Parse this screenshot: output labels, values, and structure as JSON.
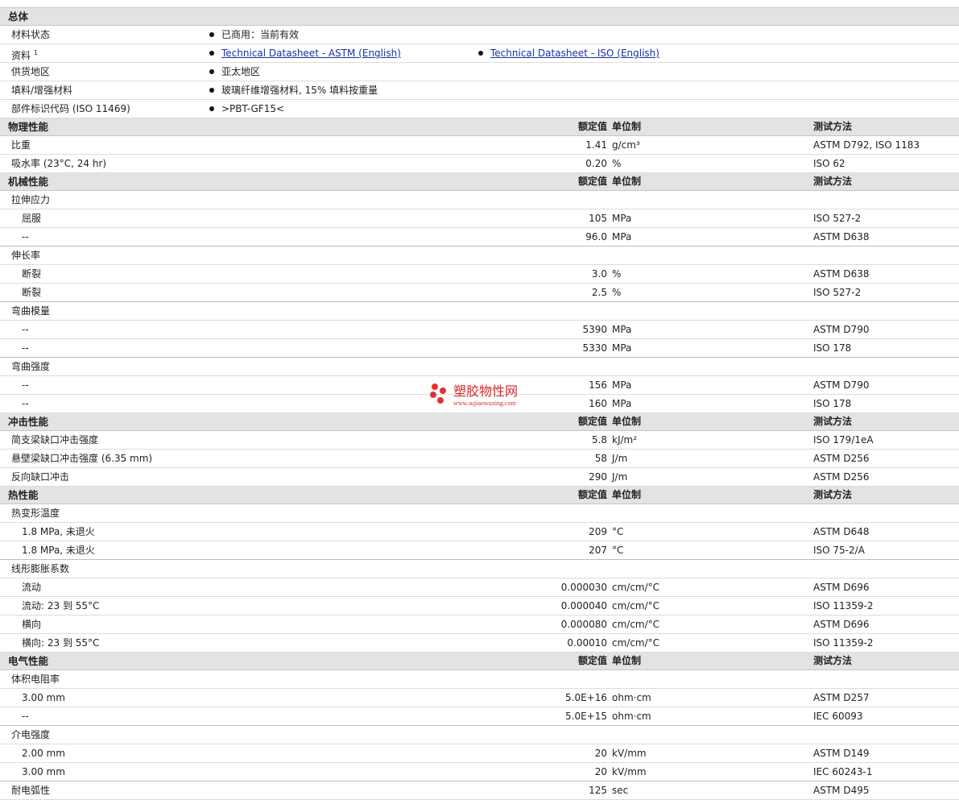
{
  "sections": [
    {
      "title": "总体",
      "rows": [
        {
          "label": "材料状态",
          "bullets": [
            {
              "text": "已商用：当前有效"
            }
          ]
        },
        {
          "label": "资料",
          "sup": "1",
          "bullets": [
            {
              "text": "Technical Datasheet - ASTM (English)",
              "link": true
            },
            {
              "text": "Technical Datasheet - ISO (English)",
              "link": true
            }
          ]
        },
        {
          "label": "供货地区",
          "bullets": [
            {
              "text": "亚太地区"
            }
          ]
        },
        {
          "label": "填料/增强材料",
          "bullets": [
            {
              "text": "玻璃纤维增强材料, 15% 填料按重量"
            }
          ]
        },
        {
          "label": "部件标识代码 (ISO 11469)",
          "bullets": [
            {
              "text": ">PBT-GF15<"
            }
          ]
        }
      ]
    },
    {
      "title": "物理性能",
      "h_val": "额定值",
      "h_unit": "单位制",
      "h_meth": "测试方法",
      "rows": [
        {
          "label": "比重",
          "value": "1.41",
          "unit": "g/cm³",
          "method": "ASTM D792, ISO 1183"
        },
        {
          "label": "吸水率 (23°C, 24 hr)",
          "value": "0.20",
          "unit": "%",
          "method": "ISO 62"
        }
      ]
    },
    {
      "title": "机械性能",
      "h_val": "额定值",
      "h_unit": "单位制",
      "h_meth": "测试方法",
      "rows": [
        {
          "label": "拉伸应力"
        },
        {
          "label": "屈服",
          "sub": true,
          "value": "105",
          "unit": "MPa",
          "method": "ISO 527-2"
        },
        {
          "label": "--",
          "sub": true,
          "value": "96.0",
          "unit": "MPa",
          "method": "ASTM D638",
          "end": true
        },
        {
          "label": "伸长率"
        },
        {
          "label": "断裂",
          "sub": true,
          "value": "3.0",
          "unit": "%",
          "method": "ASTM D638"
        },
        {
          "label": "断裂",
          "sub": true,
          "value": "2.5",
          "unit": "%",
          "method": "ISO 527-2",
          "end": true
        },
        {
          "label": "弯曲模量"
        },
        {
          "label": "--",
          "sub": true,
          "value": "5390",
          "unit": "MPa",
          "method": "ASTM D790"
        },
        {
          "label": "--",
          "sub": true,
          "value": "5330",
          "unit": "MPa",
          "method": "ISO 178",
          "end": true
        },
        {
          "label": "弯曲强度"
        },
        {
          "label": "--",
          "sub": true,
          "value": "156",
          "unit": "MPa",
          "method": "ASTM D790"
        },
        {
          "label": "--",
          "sub": true,
          "value": "160",
          "unit": "MPa",
          "method": "ISO 178"
        }
      ]
    },
    {
      "title": "冲击性能",
      "h_val": "额定值",
      "h_unit": "单位制",
      "h_meth": "测试方法",
      "rows": [
        {
          "label": "简支梁缺口冲击强度",
          "value": "5.8",
          "unit": "kJ/m²",
          "method": "ISO 179/1eA"
        },
        {
          "label": "悬壁梁缺口冲击强度 (6.35 mm)",
          "value": "58",
          "unit": "J/m",
          "method": "ASTM D256"
        },
        {
          "label": "反向缺口冲击",
          "value": "290",
          "unit": "J/m",
          "method": "ASTM D256"
        }
      ]
    },
    {
      "title": "热性能",
      "h_val": "额定值",
      "h_unit": "单位制",
      "h_meth": "测试方法",
      "rows": [
        {
          "label": "热变形温度"
        },
        {
          "label": "1.8 MPa, 未退火",
          "sub": true,
          "value": "209",
          "unit": "°C",
          "method": "ASTM D648"
        },
        {
          "label": "1.8 MPa, 未退火",
          "sub": true,
          "value": "207",
          "unit": "°C",
          "method": "ISO 75-2/A",
          "end": true
        },
        {
          "label": "线形膨胀系数"
        },
        {
          "label": "流动",
          "sub": true,
          "value": "0.000030",
          "unit": "cm/cm/°C",
          "method": "ASTM D696"
        },
        {
          "label": "流动: 23 到 55°C",
          "sub": true,
          "value": "0.000040",
          "unit": "cm/cm/°C",
          "method": "ISO 11359-2"
        },
        {
          "label": "横向",
          "sub": true,
          "value": "0.000080",
          "unit": "cm/cm/°C",
          "method": "ASTM D696"
        },
        {
          "label": "横向: 23 到 55°C",
          "sub": true,
          "value": "0.00010",
          "unit": "cm/cm/°C",
          "method": "ISO 11359-2"
        }
      ]
    },
    {
      "title": "电气性能",
      "h_val": "额定值",
      "h_unit": "单位制",
      "h_meth": "测试方法",
      "rows": [
        {
          "label": "体积电阻率"
        },
        {
          "label": "3.00 mm",
          "sub": true,
          "value": "5.0E+16",
          "unit": "ohm·cm",
          "method": "ASTM D257"
        },
        {
          "label": "--",
          "sub": true,
          "value": "5.0E+15",
          "unit": "ohm·cm",
          "method": "IEC 60093",
          "end": true
        },
        {
          "label": "介电强度"
        },
        {
          "label": "2.00 mm",
          "sub": true,
          "value": "20",
          "unit": "kV/mm",
          "method": "ASTM D149"
        },
        {
          "label": "3.00 mm",
          "sub": true,
          "value": "20",
          "unit": "kV/mm",
          "method": "IEC 60243-1",
          "end": true
        },
        {
          "label": "耐电弧性",
          "value": "125",
          "unit": "sec",
          "method": "ASTM D495"
        }
      ]
    }
  ],
  "watermark": {
    "title": "塑胶物性网",
    "url": "www.sujiaowuxing.com",
    "color": "#d9262a"
  }
}
